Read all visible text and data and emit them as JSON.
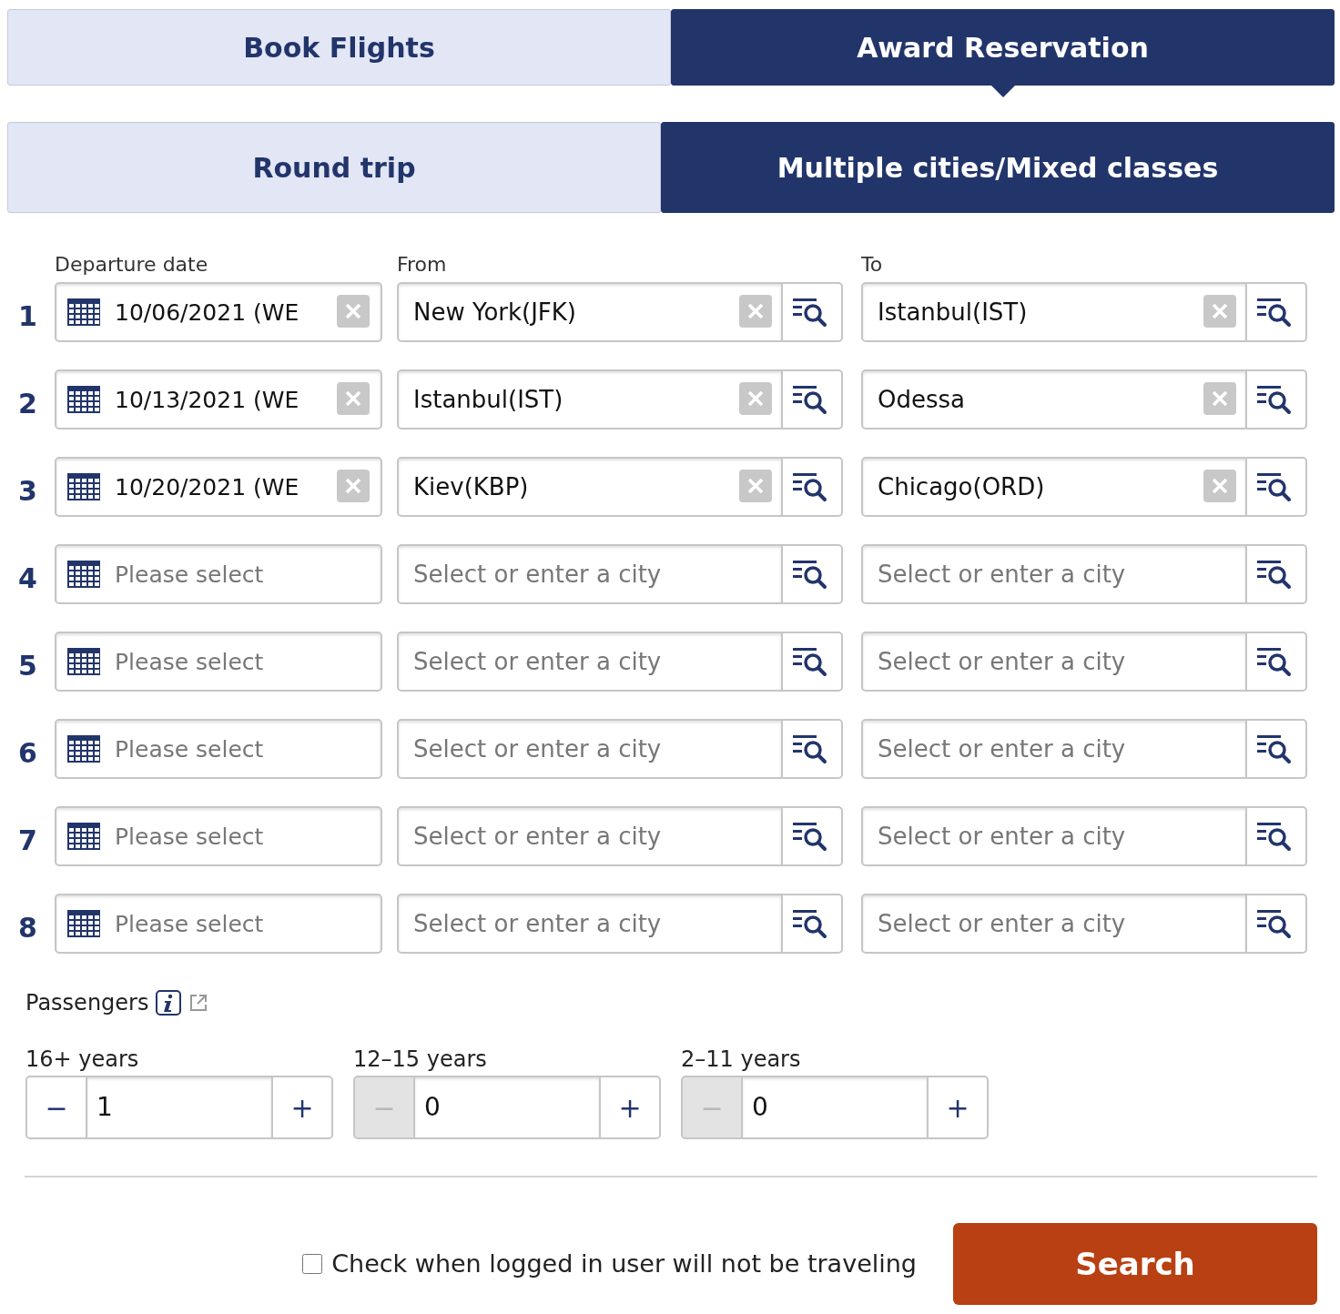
{
  "tabs": [
    {
      "label": "Book Flights",
      "selected": false
    },
    {
      "label": "Award Reservation",
      "selected": true
    }
  ],
  "trip_types": [
    {
      "label": "Round trip",
      "selected": false
    },
    {
      "label": "Multiple cities/Mixed classes",
      "selected": true
    }
  ],
  "columns": {
    "date": "Departure date",
    "from": "From",
    "to": "To"
  },
  "legs": [
    {
      "number": "1",
      "date": {
        "value": "10/06/2021 (WE"
      },
      "from": {
        "value": "New York(JFK)"
      },
      "to": {
        "value": "Istanbul(IST)"
      }
    },
    {
      "number": "2",
      "date": {
        "value": "10/13/2021 (WE"
      },
      "from": {
        "value": "Istanbul(IST)"
      },
      "to": {
        "value": "Odessa"
      }
    },
    {
      "number": "3",
      "date": {
        "value": "10/20/2021 (WE"
      },
      "from": {
        "value": "Kiev(KBP)"
      },
      "to": {
        "value": "Chicago(ORD)"
      }
    },
    {
      "number": "4",
      "date": {
        "placeholder": "Please select"
      },
      "from": {
        "placeholder": "Select or enter a city"
      },
      "to": {
        "placeholder": "Select or enter a city"
      }
    },
    {
      "number": "5",
      "date": {
        "placeholder": "Please select"
      },
      "from": {
        "placeholder": "Select or enter a city"
      },
      "to": {
        "placeholder": "Select or enter a city"
      }
    },
    {
      "number": "6",
      "date": {
        "placeholder": "Please select"
      },
      "from": {
        "placeholder": "Select or enter a city"
      },
      "to": {
        "placeholder": "Select or enter a city"
      }
    },
    {
      "number": "7",
      "date": {
        "placeholder": "Please select"
      },
      "from": {
        "placeholder": "Select or enter a city"
      },
      "to": {
        "placeholder": "Select or enter a city"
      }
    },
    {
      "number": "8",
      "date": {
        "placeholder": "Please select"
      },
      "from": {
        "placeholder": "Select or enter a city"
      },
      "to": {
        "placeholder": "Select or enter a city"
      }
    }
  ],
  "passengers": {
    "label": "Passengers",
    "groups": [
      {
        "label": "16+ years",
        "value": "1",
        "decrement": "−",
        "increment": "+",
        "decrement_disabled": false
      },
      {
        "label": "12–15 years",
        "value": "0",
        "decrement": "−",
        "increment": "+",
        "decrement_disabled": true
      },
      {
        "label": "2–11 years",
        "value": "0",
        "decrement": "−",
        "increment": "+",
        "decrement_disabled": true
      }
    ]
  },
  "not_traveling": {
    "label": "Check when logged in user will not be traveling",
    "checked": false
  },
  "search_button": "Search"
}
